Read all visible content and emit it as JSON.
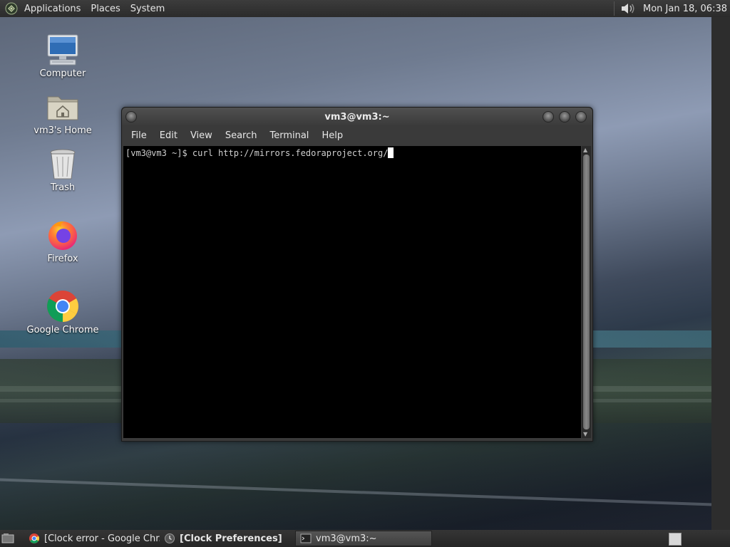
{
  "top_panel": {
    "menus": [
      "Applications",
      "Places",
      "System"
    ],
    "clock": "Mon Jan 18, 06:38"
  },
  "desktop_icons": [
    {
      "label": "Computer"
    },
    {
      "label": "vm3's Home"
    },
    {
      "label": "Trash"
    },
    {
      "label": "Firefox"
    },
    {
      "label": "Google Chrome"
    }
  ],
  "terminal": {
    "title": "vm3@vm3:~",
    "menus": [
      "File",
      "Edit",
      "View",
      "Search",
      "Terminal",
      "Help"
    ],
    "prompt": "[vm3@vm3 ~]$ ",
    "command": "curl http://mirrors.fedoraproject.org/"
  },
  "taskbar": {
    "tasks": [
      {
        "label": "[Clock error - Google Chr..."
      },
      {
        "label": "[Clock Preferences]"
      },
      {
        "label": "vm3@vm3:~"
      }
    ]
  }
}
